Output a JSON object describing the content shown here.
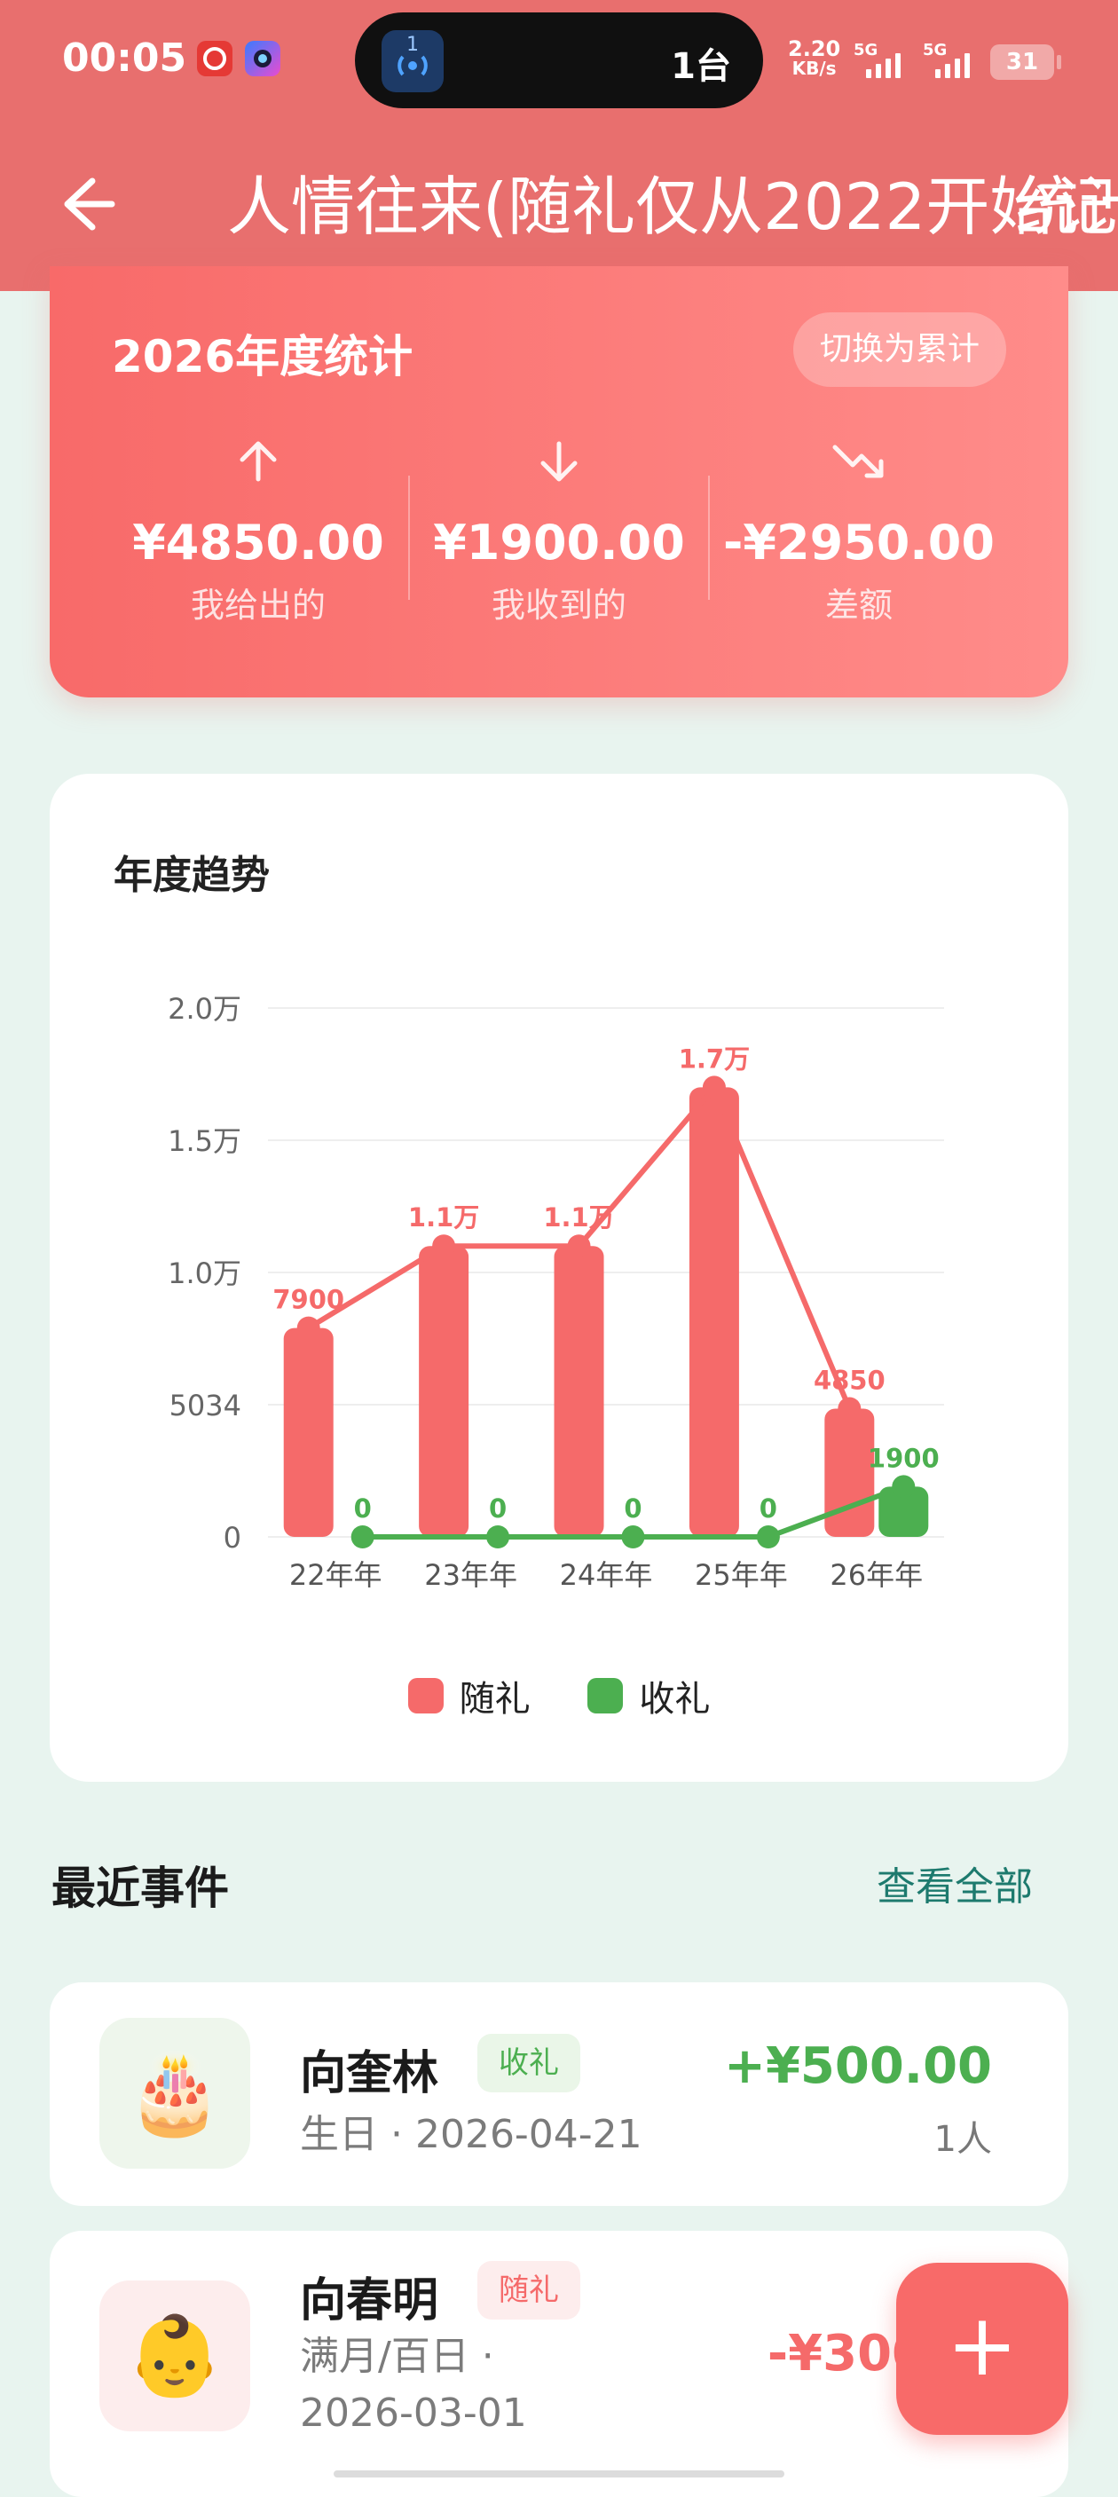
{
  "status_bar": {
    "time": "00:05",
    "island_icon_text": "1",
    "island_text": "1台",
    "speed_value": "2.20",
    "speed_unit": "KB/s",
    "sim1": "5G",
    "sim2": "5G",
    "battery": "31"
  },
  "header": {
    "title": "人情往来(随礼仅从2022开始记",
    "overflow_text": "统计"
  },
  "summary": {
    "title": "2026年度统计",
    "switch_label": "切换为累计",
    "given_amount": "¥4850.00",
    "given_label": "我给出的",
    "received_amount": "¥1900.00",
    "received_label": "我收到的",
    "diff_amount": "-¥2950.00",
    "diff_label": "差额"
  },
  "trend": {
    "title": "年度趋势",
    "legend_given": "随礼",
    "legend_received": "收礼"
  },
  "chart_data": {
    "type": "bar",
    "title": "年度趋势",
    "categories": [
      "22年年",
      "23年年",
      "24年年",
      "25年年",
      "26年年"
    ],
    "y_ticks": [
      "0",
      "5034",
      "1.0万",
      "1.5万",
      "2.0万"
    ],
    "ylim": [
      0,
      20000
    ],
    "grid": true,
    "legend_position": "bottom",
    "series": [
      {
        "name": "随礼",
        "color": "#F56A6A",
        "values": [
          7900,
          11000,
          11000,
          17000,
          4850
        ],
        "labels": [
          "7900",
          "1.1万",
          "1.1万",
          "1.7万",
          "4850"
        ]
      },
      {
        "name": "收礼",
        "color": "#4CAF50",
        "values": [
          0,
          0,
          0,
          0,
          1900
        ],
        "labels": [
          "0",
          "0",
          "0",
          "0",
          "1900"
        ]
      }
    ]
  },
  "recent": {
    "title": "最近事件",
    "view_all": "查看全部",
    "events": [
      {
        "icon": "🎂",
        "name": "向奎林",
        "tag": "收礼",
        "sub": "生日 · 2026-04-21",
        "amount": "+¥500.00",
        "people": "1人"
      },
      {
        "icon": "👶",
        "name": "向春明",
        "tag": "随礼",
        "sub_line1": "满月/百日 ·",
        "sub_line2": "2026-03-01",
        "amount": "-¥300"
      }
    ]
  },
  "fab": {
    "label": "+"
  },
  "colors": {
    "accent": "#F86A69",
    "green": "#4CAF50",
    "header": "#E86F6E",
    "link": "#1D7A6E"
  }
}
